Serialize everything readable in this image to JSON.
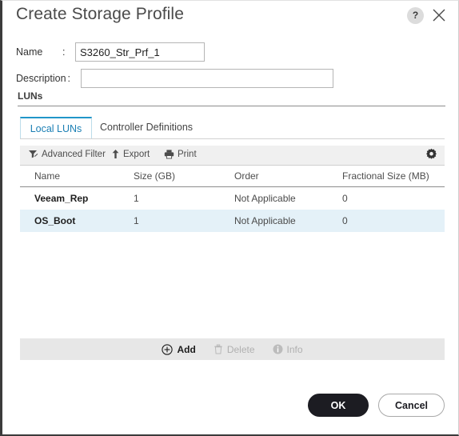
{
  "dialog": {
    "title": "Create Storage Profile",
    "help_icon": "question-mark-icon",
    "close_icon": "close-icon"
  },
  "form": {
    "name": {
      "label": "Name",
      "colon": ":",
      "value": "S3260_Str_Prf_1",
      "placeholder": ""
    },
    "description": {
      "label": "Description",
      "colon": ":",
      "value": "",
      "placeholder": ""
    }
  },
  "section": {
    "title": "LUNs"
  },
  "tabs": [
    {
      "label": "Local LUNs",
      "active": true
    },
    {
      "label": "Controller Definitions",
      "active": false
    }
  ],
  "toolbar": {
    "advanced_filter": "Advanced Filter",
    "export": "Export",
    "print": "Print",
    "settings_icon": "gear-icon"
  },
  "table": {
    "columns": [
      "Name",
      "Size (GB)",
      "Order",
      "Fractional Size (MB)"
    ],
    "rows": [
      {
        "name": "Veeam_Rep",
        "size": "1",
        "order": "Not Applicable",
        "fractional_size": "0",
        "selected": false
      },
      {
        "name": "OS_Boot",
        "size": "1",
        "order": "Not Applicable",
        "fractional_size": "0",
        "selected": true
      }
    ]
  },
  "actions": {
    "add": "Add",
    "delete": "Delete",
    "info": "Info"
  },
  "footer": {
    "ok": "OK",
    "cancel": "Cancel"
  },
  "colors": {
    "accent": "#2196c9",
    "tab_active_text": "#1b7fb4",
    "row_selected": "#e4f1f8",
    "toolbar_bg": "#f0f0f0",
    "actionbar_bg": "#e7e7e7",
    "primary_button": "#1c1c22"
  }
}
